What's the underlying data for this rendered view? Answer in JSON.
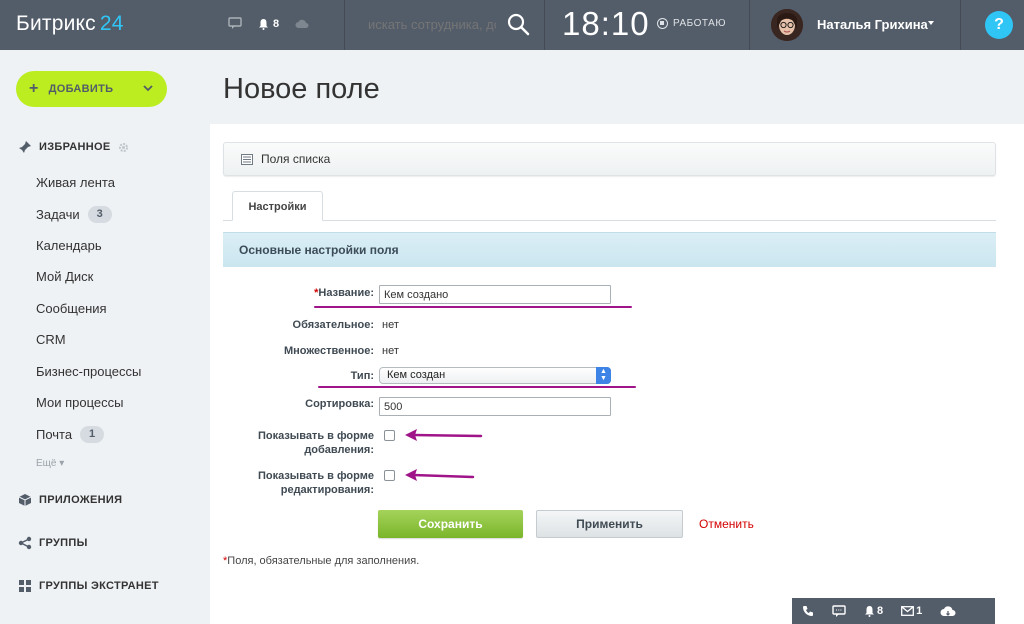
{
  "app": {
    "logo_text": "Битрикс",
    "logo_num": "24"
  },
  "header": {
    "notifications_count": "8",
    "search_placeholder": "искать сотрудника, до",
    "clock": "18:10",
    "work_status": "РАБОТАЮ",
    "user_name": "Наталья Грихина",
    "help_label": "?"
  },
  "sidebar": {
    "add_label": "ДОБАВИТЬ",
    "favorites_label": "ИЗБРАННОЕ",
    "items": [
      {
        "label": "Живая лента",
        "counter": ""
      },
      {
        "label": "Задачи",
        "counter": "3"
      },
      {
        "label": "Календарь",
        "counter": ""
      },
      {
        "label": "Мой Диск",
        "counter": ""
      },
      {
        "label": "Сообщения",
        "counter": ""
      },
      {
        "label": "CRM",
        "counter": ""
      },
      {
        "label": "Бизнес-процессы",
        "counter": ""
      },
      {
        "label": "Мои процессы",
        "counter": ""
      },
      {
        "label": "Почта",
        "counter": "1"
      }
    ],
    "more_label": "Ещё",
    "apps_label": "ПРИЛОЖЕНИЯ",
    "groups_label": "ГРУППЫ",
    "extranet_label": "ГРУППЫ ЭКСТРАНЕТ"
  },
  "main": {
    "title": "Новое поле",
    "list_fields_label": "Поля списка",
    "tab_settings": "Настройки",
    "section_title": "Основные настройки поля",
    "form": {
      "name_label": "Название:",
      "name_value": "Кем создано",
      "required_label": "Обязательное:",
      "required_value": "нет",
      "multiple_label": "Множественное:",
      "multiple_value": "нет",
      "type_label": "Тип:",
      "type_value": "Кем создан",
      "sort_label": "Сортировка:",
      "sort_value": "500",
      "show_add_label_1": "Показывать в форме",
      "show_add_label_2": "добавления:",
      "show_edit_label_1": "Показывать в форме",
      "show_edit_label_2": "редактирования:"
    },
    "buttons": {
      "save": "Сохранить",
      "apply": "Применить",
      "cancel": "Отменить"
    },
    "footnote": "Поля, обязательные для заполнения."
  },
  "dock": {
    "notifications": "8",
    "messages": "1"
  },
  "colors": {
    "topbar": "#535c69",
    "accent": "#2fc6f6",
    "add_button": "#bbed21",
    "annotation": "#a0148a",
    "save": "#8cc33f"
  }
}
